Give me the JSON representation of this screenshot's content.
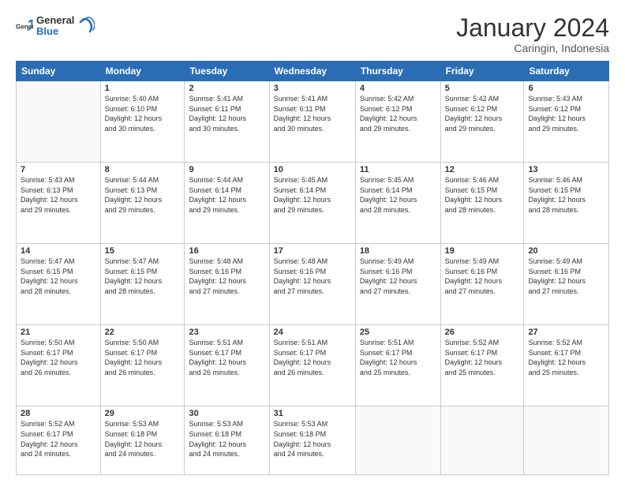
{
  "header": {
    "logo_general": "General",
    "logo_blue": "Blue",
    "month_title": "January 2024",
    "location": "Caringin, Indonesia"
  },
  "weekdays": [
    "Sunday",
    "Monday",
    "Tuesday",
    "Wednesday",
    "Thursday",
    "Friday",
    "Saturday"
  ],
  "weeks": [
    [
      {
        "day": "",
        "info": ""
      },
      {
        "day": "1",
        "info": "Sunrise: 5:40 AM\nSunset: 6:10 PM\nDaylight: 12 hours\nand 30 minutes."
      },
      {
        "day": "2",
        "info": "Sunrise: 5:41 AM\nSunset: 6:11 PM\nDaylight: 12 hours\nand 30 minutes."
      },
      {
        "day": "3",
        "info": "Sunrise: 5:41 AM\nSunset: 6:11 PM\nDaylight: 12 hours\nand 30 minutes."
      },
      {
        "day": "4",
        "info": "Sunrise: 5:42 AM\nSunset: 6:12 PM\nDaylight: 12 hours\nand 29 minutes."
      },
      {
        "day": "5",
        "info": "Sunrise: 5:42 AM\nSunset: 6:12 PM\nDaylight: 12 hours\nand 29 minutes."
      },
      {
        "day": "6",
        "info": "Sunrise: 5:43 AM\nSunset: 6:12 PM\nDaylight: 12 hours\nand 29 minutes."
      }
    ],
    [
      {
        "day": "7",
        "info": "Sunrise: 5:43 AM\nSunset: 6:13 PM\nDaylight: 12 hours\nand 29 minutes."
      },
      {
        "day": "8",
        "info": "Sunrise: 5:44 AM\nSunset: 6:13 PM\nDaylight: 12 hours\nand 29 minutes."
      },
      {
        "day": "9",
        "info": "Sunrise: 5:44 AM\nSunset: 6:14 PM\nDaylight: 12 hours\nand 29 minutes."
      },
      {
        "day": "10",
        "info": "Sunrise: 5:45 AM\nSunset: 6:14 PM\nDaylight: 12 hours\nand 29 minutes."
      },
      {
        "day": "11",
        "info": "Sunrise: 5:45 AM\nSunset: 6:14 PM\nDaylight: 12 hours\nand 28 minutes."
      },
      {
        "day": "12",
        "info": "Sunrise: 5:46 AM\nSunset: 6:15 PM\nDaylight: 12 hours\nand 28 minutes."
      },
      {
        "day": "13",
        "info": "Sunrise: 5:46 AM\nSunset: 6:15 PM\nDaylight: 12 hours\nand 28 minutes."
      }
    ],
    [
      {
        "day": "14",
        "info": "Sunrise: 5:47 AM\nSunset: 6:15 PM\nDaylight: 12 hours\nand 28 minutes."
      },
      {
        "day": "15",
        "info": "Sunrise: 5:47 AM\nSunset: 6:15 PM\nDaylight: 12 hours\nand 28 minutes."
      },
      {
        "day": "16",
        "info": "Sunrise: 5:48 AM\nSunset: 6:16 PM\nDaylight: 12 hours\nand 27 minutes."
      },
      {
        "day": "17",
        "info": "Sunrise: 5:48 AM\nSunset: 6:16 PM\nDaylight: 12 hours\nand 27 minutes."
      },
      {
        "day": "18",
        "info": "Sunrise: 5:49 AM\nSunset: 6:16 PM\nDaylight: 12 hours\nand 27 minutes."
      },
      {
        "day": "19",
        "info": "Sunrise: 5:49 AM\nSunset: 6:16 PM\nDaylight: 12 hours\nand 27 minutes."
      },
      {
        "day": "20",
        "info": "Sunrise: 5:49 AM\nSunset: 6:16 PM\nDaylight: 12 hours\nand 27 minutes."
      }
    ],
    [
      {
        "day": "21",
        "info": "Sunrise: 5:50 AM\nSunset: 6:17 PM\nDaylight: 12 hours\nand 26 minutes."
      },
      {
        "day": "22",
        "info": "Sunrise: 5:50 AM\nSunset: 6:17 PM\nDaylight: 12 hours\nand 26 minutes."
      },
      {
        "day": "23",
        "info": "Sunrise: 5:51 AM\nSunset: 6:17 PM\nDaylight: 12 hours\nand 26 minutes."
      },
      {
        "day": "24",
        "info": "Sunrise: 5:51 AM\nSunset: 6:17 PM\nDaylight: 12 hours\nand 26 minutes."
      },
      {
        "day": "25",
        "info": "Sunrise: 5:51 AM\nSunset: 6:17 PM\nDaylight: 12 hours\nand 25 minutes."
      },
      {
        "day": "26",
        "info": "Sunrise: 5:52 AM\nSunset: 6:17 PM\nDaylight: 12 hours\nand 25 minutes."
      },
      {
        "day": "27",
        "info": "Sunrise: 5:52 AM\nSunset: 6:17 PM\nDaylight: 12 hours\nand 25 minutes."
      }
    ],
    [
      {
        "day": "28",
        "info": "Sunrise: 5:52 AM\nSunset: 6:17 PM\nDaylight: 12 hours\nand 24 minutes."
      },
      {
        "day": "29",
        "info": "Sunrise: 5:53 AM\nSunset: 6:18 PM\nDaylight: 12 hours\nand 24 minutes."
      },
      {
        "day": "30",
        "info": "Sunrise: 5:53 AM\nSunset: 6:18 PM\nDaylight: 12 hours\nand 24 minutes."
      },
      {
        "day": "31",
        "info": "Sunrise: 5:53 AM\nSunset: 6:18 PM\nDaylight: 12 hours\nand 24 minutes."
      },
      {
        "day": "",
        "info": ""
      },
      {
        "day": "",
        "info": ""
      },
      {
        "day": "",
        "info": ""
      }
    ]
  ]
}
